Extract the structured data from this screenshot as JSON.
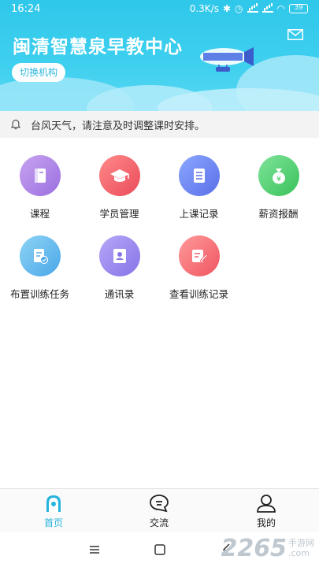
{
  "status": {
    "time": "16:24",
    "speed": "0.3K/s",
    "battery": "39"
  },
  "header": {
    "title": "闽清智慧泉早教中心",
    "switch_label": "切换机构"
  },
  "notice": {
    "text": "台风天气，请注意及时调整课时安排。"
  },
  "grid": [
    {
      "label": "课程",
      "icon": "book-icon",
      "color": "#9b6fe0"
    },
    {
      "label": "学员管理",
      "icon": "graduation-cap-icon",
      "color": "#ea4b5a"
    },
    {
      "label": "上课记录",
      "icon": "document-list-icon",
      "color": "#5a6fe8"
    },
    {
      "label": "薪资报酬",
      "icon": "money-bag-icon",
      "color": "#39c25a"
    },
    {
      "label": "布置训练任务",
      "icon": "task-check-icon",
      "color": "#4aa7e8"
    },
    {
      "label": "通讯录",
      "icon": "contact-card-icon",
      "color": "#8673e8"
    },
    {
      "label": "查看训练记录",
      "icon": "edit-record-icon",
      "color": "#ef5560"
    }
  ],
  "nav": [
    {
      "label": "首页",
      "icon": "home-icon",
      "active": true
    },
    {
      "label": "交流",
      "icon": "chat-icon",
      "active": false
    },
    {
      "label": "我的",
      "icon": "user-icon",
      "active": false
    }
  ],
  "watermark": {
    "num": "2265",
    "cn": "手游网",
    "domain": ".com"
  },
  "colors": {
    "accent": "#27b4de",
    "header": "#2fc7ea"
  }
}
